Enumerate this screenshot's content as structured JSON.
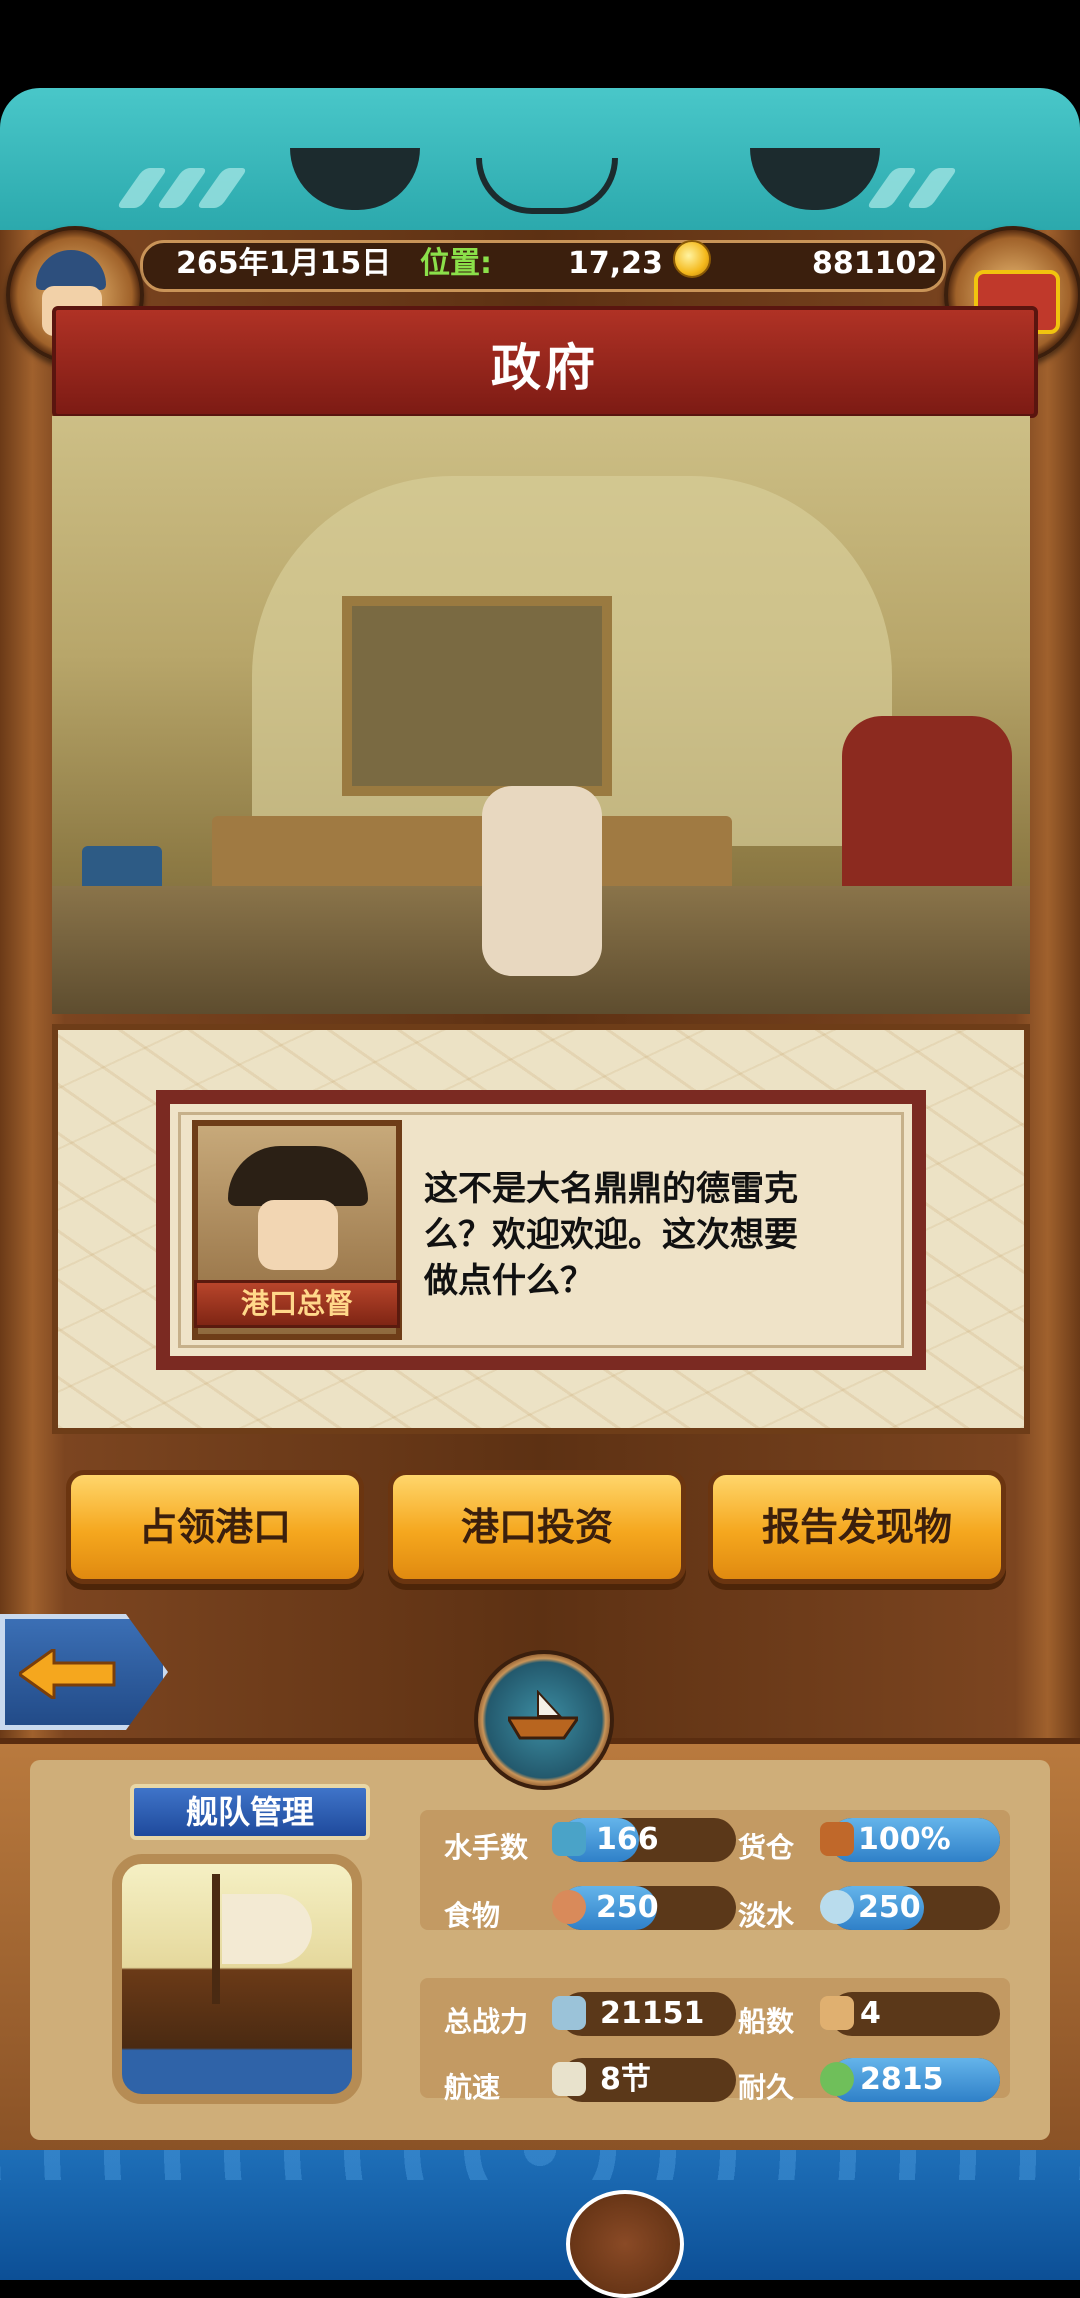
{
  "header": {
    "date": "265年1月15日",
    "position_label": "位置:",
    "position_value": "17,23",
    "gold": "881102"
  },
  "title": "政府",
  "dialog": {
    "speaker": "港口总督",
    "text": "这不是大名鼎鼎的德雷克么？欢迎欢迎。这次想要做点什么？"
  },
  "actions": [
    "占领港口",
    "港口投资",
    "报告发现物"
  ],
  "fleet": {
    "title": "舰队管理",
    "stats": [
      {
        "label": "水手数",
        "value": "166",
        "icon": "sailor-icon",
        "fill": 0.45
      },
      {
        "label": "货仓",
        "value": "100%",
        "icon": "crate-icon",
        "fill": 1.0
      },
      {
        "label": "食物",
        "value": "250",
        "icon": "meat-icon",
        "fill": 0.55
      },
      {
        "label": "淡水",
        "value": "250",
        "icon": "water-jug-icon",
        "fill": 0.55
      },
      {
        "label": "总战力",
        "value": "21151",
        "icon": "sword-icon",
        "fill": 0
      },
      {
        "label": "船数",
        "value": "4",
        "icon": "ship-count-icon",
        "fill": 0
      },
      {
        "label": "航速",
        "value": "8节",
        "icon": "sail-icon",
        "fill": 0
      },
      {
        "label": "耐久",
        "value": "2815",
        "icon": "wreath-icon",
        "fill": 1.0
      }
    ]
  },
  "colors": {
    "accent_orange": "#f5a71e",
    "title_red": "#9a2519",
    "stat_blue": "#2f80c8",
    "wood": "#6b3a17"
  }
}
